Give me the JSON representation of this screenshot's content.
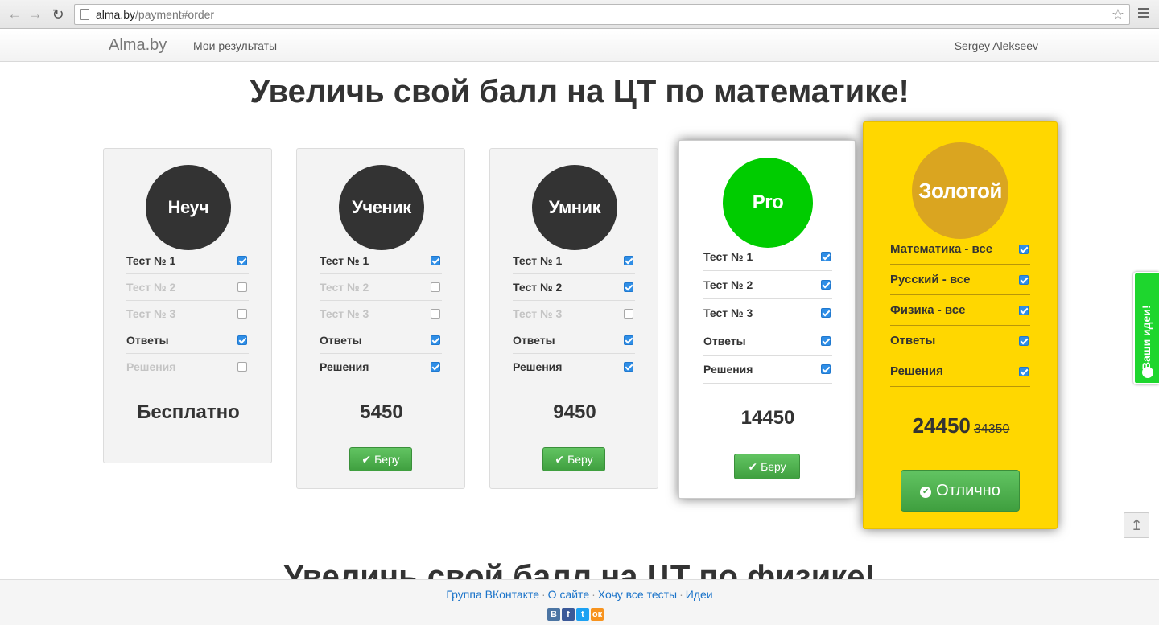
{
  "browser": {
    "url_host": "alma.by",
    "url_path": "/payment#order"
  },
  "navbar": {
    "brand": "Alma.by",
    "link": "Мои результаты",
    "user": "Sergey Alekseev"
  },
  "heading": "Увеличь свой балл на ЦТ по математике!",
  "heading_next": "Увеличь свой балл на ЦТ по физике!",
  "plans": [
    {
      "name": "Неуч",
      "color": "#333333",
      "features": [
        {
          "label": "Тест № 1",
          "checked": true
        },
        {
          "label": "Тест № 2",
          "checked": false
        },
        {
          "label": "Тест № 3",
          "checked": false
        },
        {
          "label": "Ответы",
          "checked": true
        },
        {
          "label": "Решения",
          "checked": false
        }
      ],
      "price": "Бесплатно"
    },
    {
      "name": "Ученик",
      "color": "#333333",
      "features": [
        {
          "label": "Тест № 1",
          "checked": true
        },
        {
          "label": "Тест № 2",
          "checked": false
        },
        {
          "label": "Тест № 3",
          "checked": false
        },
        {
          "label": "Ответы",
          "checked": true
        },
        {
          "label": "Решения",
          "checked": true
        }
      ],
      "price": "5450",
      "button": "Беру"
    },
    {
      "name": "Умник",
      "color": "#333333",
      "features": [
        {
          "label": "Тест № 1",
          "checked": true
        },
        {
          "label": "Тест № 2",
          "checked": true
        },
        {
          "label": "Тест № 3",
          "checked": false
        },
        {
          "label": "Ответы",
          "checked": true
        },
        {
          "label": "Решения",
          "checked": true
        }
      ],
      "price": "9450",
      "button": "Беру"
    },
    {
      "name": "Pro",
      "color": "#00cc00",
      "features": [
        {
          "label": "Тест № 1",
          "checked": true
        },
        {
          "label": "Тест № 2",
          "checked": true
        },
        {
          "label": "Тест № 3",
          "checked": true
        },
        {
          "label": "Ответы",
          "checked": true
        },
        {
          "label": "Решения",
          "checked": true
        }
      ],
      "price": "14450",
      "button": "Беру"
    },
    {
      "name": "Золотой",
      "color": "#daa520",
      "features": [
        {
          "label": "Математика - все",
          "checked": true
        },
        {
          "label": "Русский - все",
          "checked": true
        },
        {
          "label": "Физика - все",
          "checked": true
        },
        {
          "label": "Ответы",
          "checked": true
        },
        {
          "label": "Решения",
          "checked": true
        }
      ],
      "price": "24450",
      "price_old": "34350",
      "button": "Отлично"
    }
  ],
  "side_tab": "Ваши идеи!",
  "footer": {
    "links": [
      "Группа ВКонтакте",
      "О сайте",
      "Хочу все тесты",
      "Идеи"
    ],
    "separator": "·",
    "socials": [
      {
        "name": "vk-icon",
        "glyph": "B",
        "color": "#4c75a3"
      },
      {
        "name": "facebook-icon",
        "glyph": "f",
        "color": "#3b5998"
      },
      {
        "name": "twitter-icon",
        "glyph": "t",
        "color": "#1da1f2"
      },
      {
        "name": "odnoklassniki-icon",
        "glyph": "ок",
        "color": "#f7931e"
      }
    ]
  }
}
